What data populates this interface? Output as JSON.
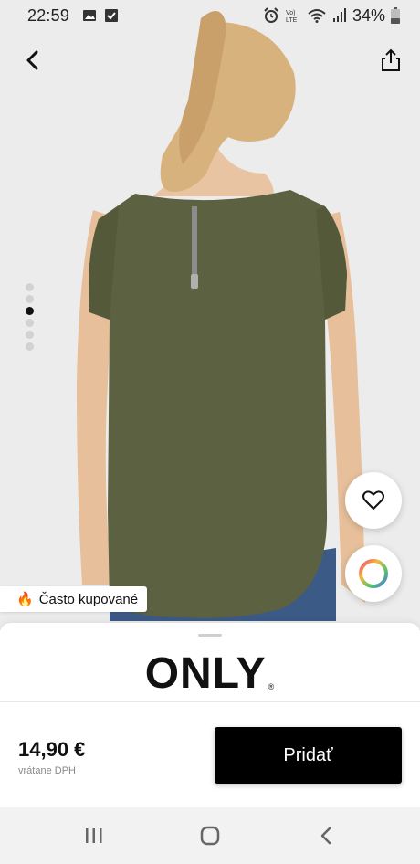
{
  "status_bar": {
    "time": "22:59",
    "battery": "34%",
    "icons_left": [
      "image-icon",
      "check-icon"
    ],
    "icons_right": [
      "alarm-icon",
      "volte-icon",
      "wifi-icon",
      "signal-icon",
      "battery-icon"
    ]
  },
  "product": {
    "image_count": 6,
    "active_image_index": 2,
    "badge_emoji": "🔥",
    "badge_text": "Často kupované",
    "brand": "ONLY",
    "price": "14,90 €",
    "vat_note": "vrátane DPH",
    "add_button_label": "Pridať"
  },
  "colors": {
    "accent": "#000000",
    "shirt": "#5b6141"
  }
}
